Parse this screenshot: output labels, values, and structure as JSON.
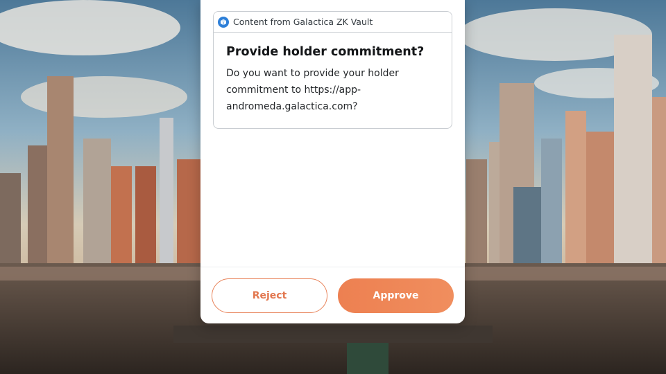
{
  "snap": {
    "header_text": "Content from Galactica ZK Vault",
    "icon": "galactica-cube-icon",
    "title": "Provide holder commitment?",
    "message": "Do you want to provide your holder commitment to https://app-andromeda.galactica.com?"
  },
  "actions": {
    "reject_label": "Reject",
    "approve_label": "Approve"
  },
  "colors": {
    "accent": "#ED8051",
    "snap_icon": "#2D7FD8"
  }
}
